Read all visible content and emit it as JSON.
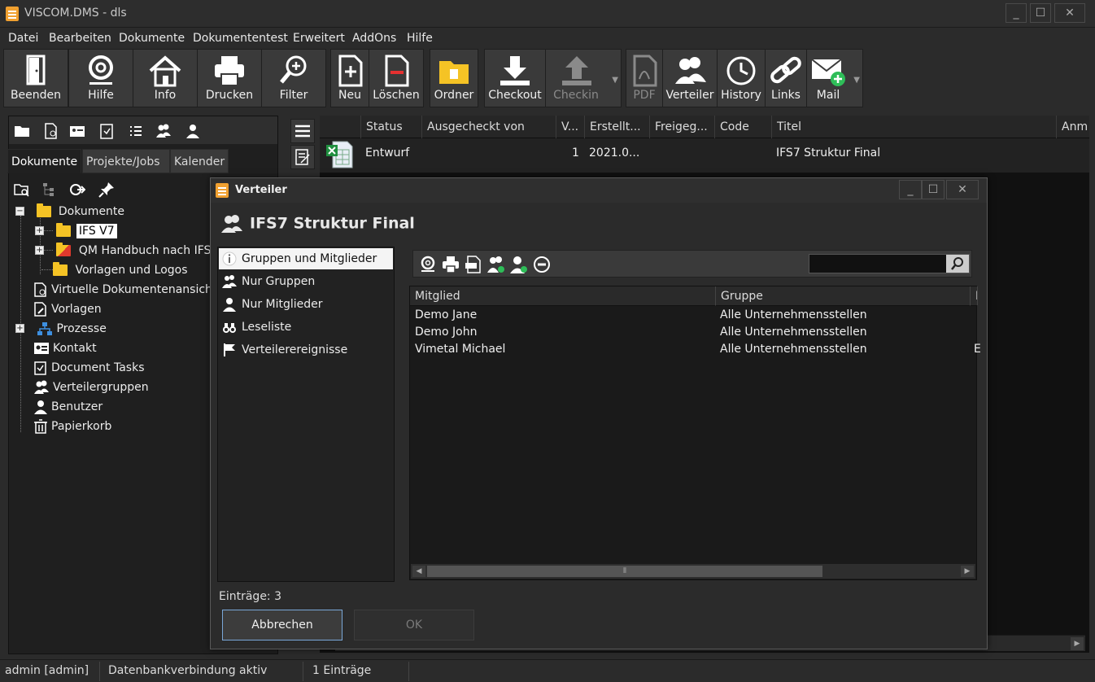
{
  "window": {
    "title": "VISCOM.DMS - dls"
  },
  "menu": [
    "Datei",
    "Bearbeiten",
    "Dokumente",
    "Dokumententest",
    "Erweitert",
    "AddOns",
    "Hilfe"
  ],
  "toolbar": {
    "beenden": "Beenden",
    "hilfe": "Hilfe",
    "info": "Info",
    "drucken": "Drucken",
    "filter": "Filter",
    "neu": "Neu",
    "loeschen": "Löschen",
    "ordner": "Ordner",
    "checkout": "Checkout",
    "checkin": "Checkin",
    "pdf": "PDF",
    "verteiler": "Verteiler",
    "history": "History",
    "links": "Links",
    "mail": "Mail"
  },
  "left_tabs": [
    "Dokumente",
    "Projekte/Jobs",
    "Kalender"
  ],
  "tree": {
    "dokumente": "Dokumente",
    "ifs_v7": "IFS V7",
    "qm_handbuch": "QM Handbuch nach IFS",
    "vorlagen_logos": "Vorlagen und Logos",
    "virtuelle": "Virtuelle Dokumentenansich",
    "vorlagen": "Vorlagen",
    "prozesse": "Prozesse",
    "kontakt": "Kontakt",
    "document_tasks": "Document Tasks",
    "verteilergruppen": "Verteilergruppen",
    "benutzer": "Benutzer",
    "papierkorb": "Papierkorb"
  },
  "grid": {
    "headers": [
      "Status",
      "Ausgecheckt von",
      "V...",
      "Erstellt...",
      "Freigeg...",
      "Code",
      "Titel",
      "Anm"
    ],
    "row": {
      "status": "Entwurf",
      "version": "1",
      "erstellt": "2021.0...",
      "titel": "IFS7 Struktur Final"
    }
  },
  "statusbar": {
    "user": "admin [admin]",
    "db": "Datenbankverbindung aktiv",
    "count": "1 Einträge"
  },
  "dialog": {
    "title": "Verteiler",
    "header": "IFS7 Struktur Final",
    "nav": [
      "Gruppen und Mitglieder",
      "Nur Gruppen",
      "Nur Mitglieder",
      "Leseliste",
      "Verteilerereignisse"
    ],
    "members_headers": [
      "Mitglied",
      "Gruppe",
      "I"
    ],
    "members": [
      {
        "mitglied": "Demo Jane",
        "gruppe": "Alle Unternehmensstellen",
        "extra": ""
      },
      {
        "mitglied": "Demo John",
        "gruppe": "Alle Unternehmensstellen",
        "extra": ""
      },
      {
        "mitglied": "Vimetal Michael",
        "gruppe": "Alle Unternehmensstellen",
        "extra": "E"
      }
    ],
    "entries": "Einträge: 3",
    "cancel": "Abbrechen",
    "ok": "OK"
  }
}
